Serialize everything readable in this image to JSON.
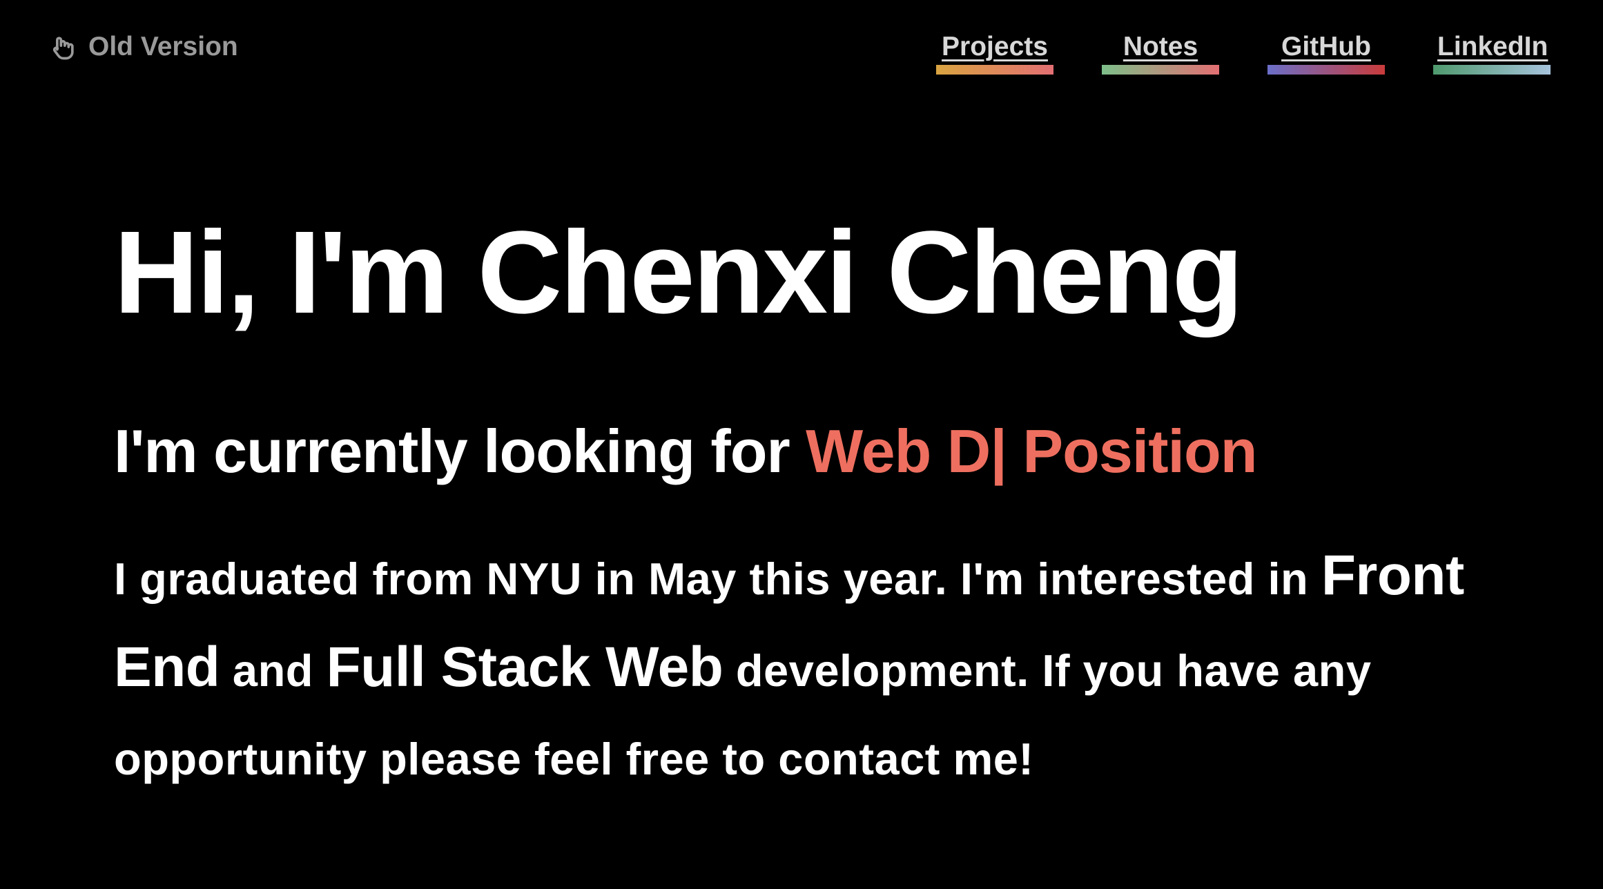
{
  "header": {
    "old_version_label": "Old Version",
    "nav": [
      {
        "label": "Projects",
        "bar_colors": [
          "#d9a441",
          "#e36f73"
        ]
      },
      {
        "label": "Notes",
        "bar_colors": [
          "#7dbf8a",
          "#e36f73"
        ]
      },
      {
        "label": "GitHub",
        "bar_colors": [
          "#6b6fc9",
          "#c93b3b"
        ]
      },
      {
        "label": "LinkedIn",
        "bar_colors": [
          "#4f9a6e",
          "#a6c3dc"
        ]
      }
    ]
  },
  "hero": {
    "title": "Hi, I'm Chenxi Cheng",
    "looking_prefix": "I'm currently looking for ",
    "looking_accent": "Web D| Position",
    "accent_color": "#ee6f5f",
    "bio": {
      "part1": "I graduated from NYU in May this year. I'm interested in ",
      "highlight1": "Front End",
      "part2": " and ",
      "highlight2": "Full Stack Web",
      "part3": " development. If you have any opportunity please feel free to contact me!"
    }
  }
}
